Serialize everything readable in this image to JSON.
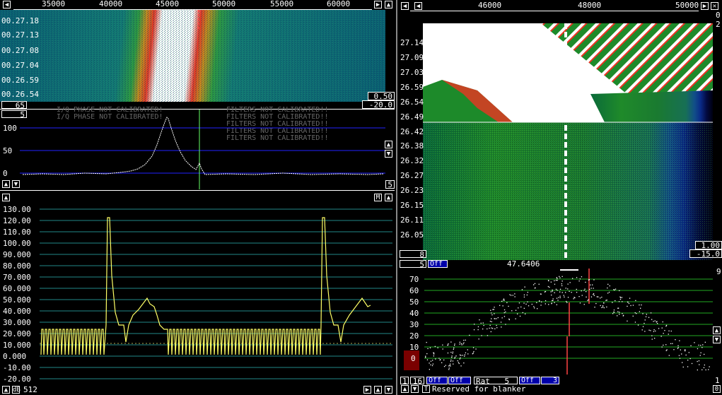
{
  "colors": {
    "waterfall_bg": "#0b6a7a",
    "spectrum_line": "#ffffff",
    "baseband_line": "#ffff66",
    "grid_blue": "#2222ff",
    "grid_teal": "#228888",
    "grid_green": "#22aa22",
    "marker_red": "#ff3333"
  },
  "left_waterfall": {
    "freq_labels": [
      "35000",
      "40000",
      "45000",
      "50000",
      "55000",
      "60000"
    ],
    "time_labels": [
      "00.27.18",
      "00.27.13",
      "00.27.08",
      "00.27.04",
      "00.26.59",
      "00.26.54"
    ],
    "gain_value": "0.50",
    "offset_value": "-20.0",
    "avg_value": "65",
    "bottom_box": "5"
  },
  "left_spectrum": {
    "y_labels": [
      "100",
      "50",
      "0"
    ],
    "warnings": [
      "I/Q PHASE NOT CALIBRATED!",
      "I/Q PHASE NOT CALIBRATED!",
      "FILTERS NOT CALIBRATED!!",
      "FILTERS NOT CALIBRATED!!",
      "FILTERS NOT CALIBRATED!!",
      "FILTERS NOT CALIBRATED!!",
      "FILTERS NOT CALIBRATED!!"
    ],
    "right_box": "5"
  },
  "baseband": {
    "y_labels": [
      "130.00",
      "120.00",
      "110.00",
      "100.00",
      "90.000",
      "80.000",
      "70.000",
      "60.000",
      "50.000",
      "40.000",
      "30.000",
      "20.000",
      "10.000",
      "0.000",
      "-10.00",
      "-20.00"
    ],
    "db_label": "dB",
    "points_label": "512",
    "m_label": "M"
  },
  "hires_waterfall": {
    "freq_labels": [
      "46000",
      "48000",
      "50000"
    ],
    "top_time_labels": [
      "27.14",
      "27.09",
      "27.03",
      "26.59",
      "26.54",
      "26.49"
    ],
    "bottom_time_labels": [
      "26.42",
      "26.38",
      "26.32",
      "26.27",
      "26.23",
      "26.15",
      "26.11",
      "26.05"
    ],
    "gain_value": "1.00",
    "offset_value": "-15.0",
    "side_digits": [
      "0",
      "2"
    ],
    "bottom_box": "8"
  },
  "hires_graph": {
    "freq_readout": "47.6406",
    "y_labels": [
      "70",
      "60",
      "50",
      "40",
      "30",
      "20",
      "10",
      "0"
    ],
    "top_box": "5",
    "off_label": "Off",
    "right_top_digit": "9",
    "right_bottom_digit": "1"
  },
  "bottom_bar": {
    "box1": "1",
    "box2": "16",
    "off1": "Off",
    "off2": "Off",
    "rat_label": "Rat",
    "rat_value": "5",
    "off3": "Off",
    "box3": "3",
    "status": "Reserved for blanker",
    "right_digit": "0"
  }
}
